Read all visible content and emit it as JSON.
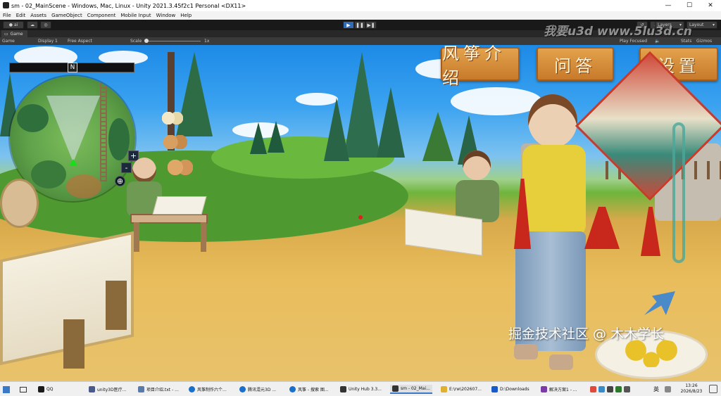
{
  "window": {
    "title": "sm - 02_MainScene - Windows, Mac, Linux - Unity 2021.3.45f2c1 Personal <DX11>",
    "minimize": "—",
    "maximize": "☐",
    "close": "✕"
  },
  "menu": [
    "File",
    "Edit",
    "Assets",
    "GameObject",
    "Component",
    "Mobile Input",
    "Window",
    "Help"
  ],
  "toolbar": {
    "account": "ai",
    "play_icon": "▶",
    "pause_icon": "❚❚",
    "step_icon": "▶❚",
    "layers": "Layers",
    "layout": "Layout"
  },
  "tabs": {
    "game": "Game"
  },
  "game_bar": {
    "view": "Game",
    "display": "Display 1",
    "aspect": "Free Aspect",
    "scale_label": "Scale",
    "scale_value": "1x",
    "play_mode": "Play Focused",
    "stats": "Stats",
    "gizmos": "Gizmos"
  },
  "scene_ui": {
    "signs": [
      "风筝介绍",
      "问答",
      "设置"
    ],
    "compass_label": "N",
    "zoom_in": "+",
    "zoom_out": "-",
    "recenter_icon": "⊕"
  },
  "watermarks": {
    "top": "我要u3d  www.5lu3d.cn",
    "bottom": "掘金技术社区 @ 木木学长"
  },
  "taskbar": {
    "items": [
      {
        "label": "QQ",
        "color": "#1a1a1a"
      },
      {
        "label": "unity3D医疗...",
        "color": "#4a5a8a"
      },
      {
        "label": "项目介绍.txt - ...",
        "color": "#5a7aa8"
      },
      {
        "label": "风筝制作六个...",
        "color": "#1a6fc8"
      },
      {
        "label": "腾讯混元3D ...",
        "color": "#1a6fc8"
      },
      {
        "label": "风筝 - 搜索 图...",
        "color": "#1a6fc8"
      },
      {
        "label": "Unity Hub 3.3...",
        "color": "#333333"
      },
      {
        "label": "sm - 02_Mai...",
        "color": "#333333"
      },
      {
        "label": "E:\\rw\\202607...",
        "color": "#e0b030"
      },
      {
        "label": "D:\\Downloads",
        "color": "#1a5ac8"
      },
      {
        "label": "解决方案1 - ...",
        "color": "#7a3aa8"
      }
    ],
    "tray_lang": "英",
    "time": "13:26",
    "date": "2026/8/23"
  }
}
